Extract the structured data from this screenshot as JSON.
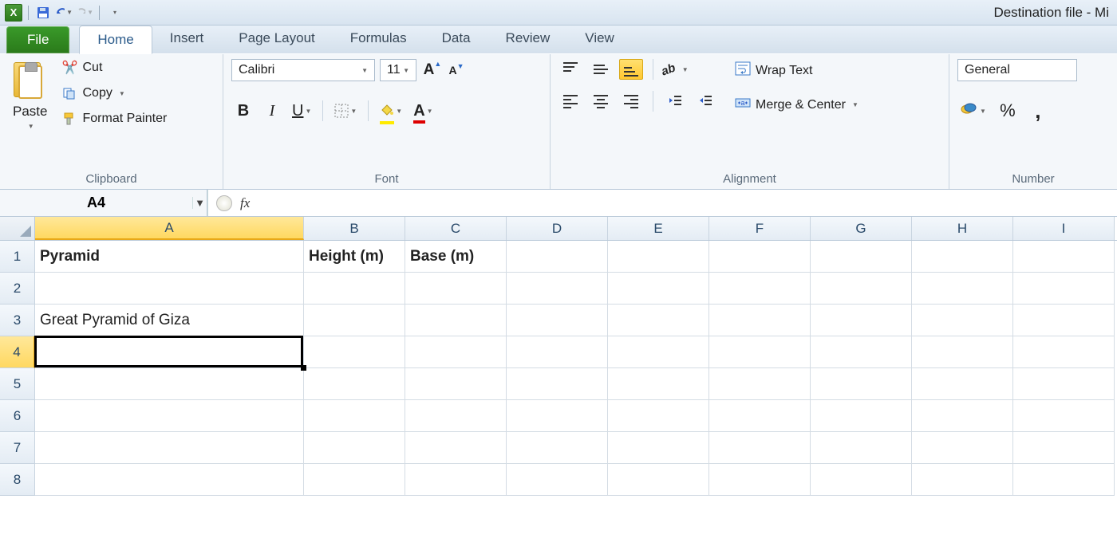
{
  "window": {
    "title": "Destination file  -  Mi"
  },
  "qat": {
    "save": "Save",
    "undo": "Undo",
    "redo": "Redo"
  },
  "tabs": {
    "file": "File",
    "items": [
      "Home",
      "Insert",
      "Page Layout",
      "Formulas",
      "Data",
      "Review",
      "View"
    ],
    "active": "Home"
  },
  "ribbon": {
    "clipboard": {
      "label": "Clipboard",
      "paste": "Paste",
      "cut": "Cut",
      "copy": "Copy",
      "fpainter": "Format Painter"
    },
    "font": {
      "label": "Font",
      "family": "Calibri",
      "size": "11",
      "bold": "B",
      "italic": "I",
      "underline": "U"
    },
    "alignment": {
      "label": "Alignment",
      "wrap": "Wrap Text",
      "merge": "Merge & Center"
    },
    "number": {
      "label": "Number",
      "format": "General",
      "pct": "%",
      "comma": ","
    }
  },
  "formula_bar": {
    "cell_ref": "A4",
    "fx": "fx",
    "value": ""
  },
  "grid": {
    "columns": [
      "A",
      "B",
      "C",
      "D",
      "E",
      "F",
      "G",
      "H",
      "I"
    ],
    "selected_col": "A",
    "row_count": 8,
    "selected_row": 4,
    "cells": {
      "A1": "Pyramid",
      "B1": "Height (m)",
      "C1": "Base (m)",
      "A3": "Great Pyramid of Giza"
    },
    "bold_cells": [
      "A1",
      "B1",
      "C1"
    ],
    "active_cell": "A4"
  }
}
